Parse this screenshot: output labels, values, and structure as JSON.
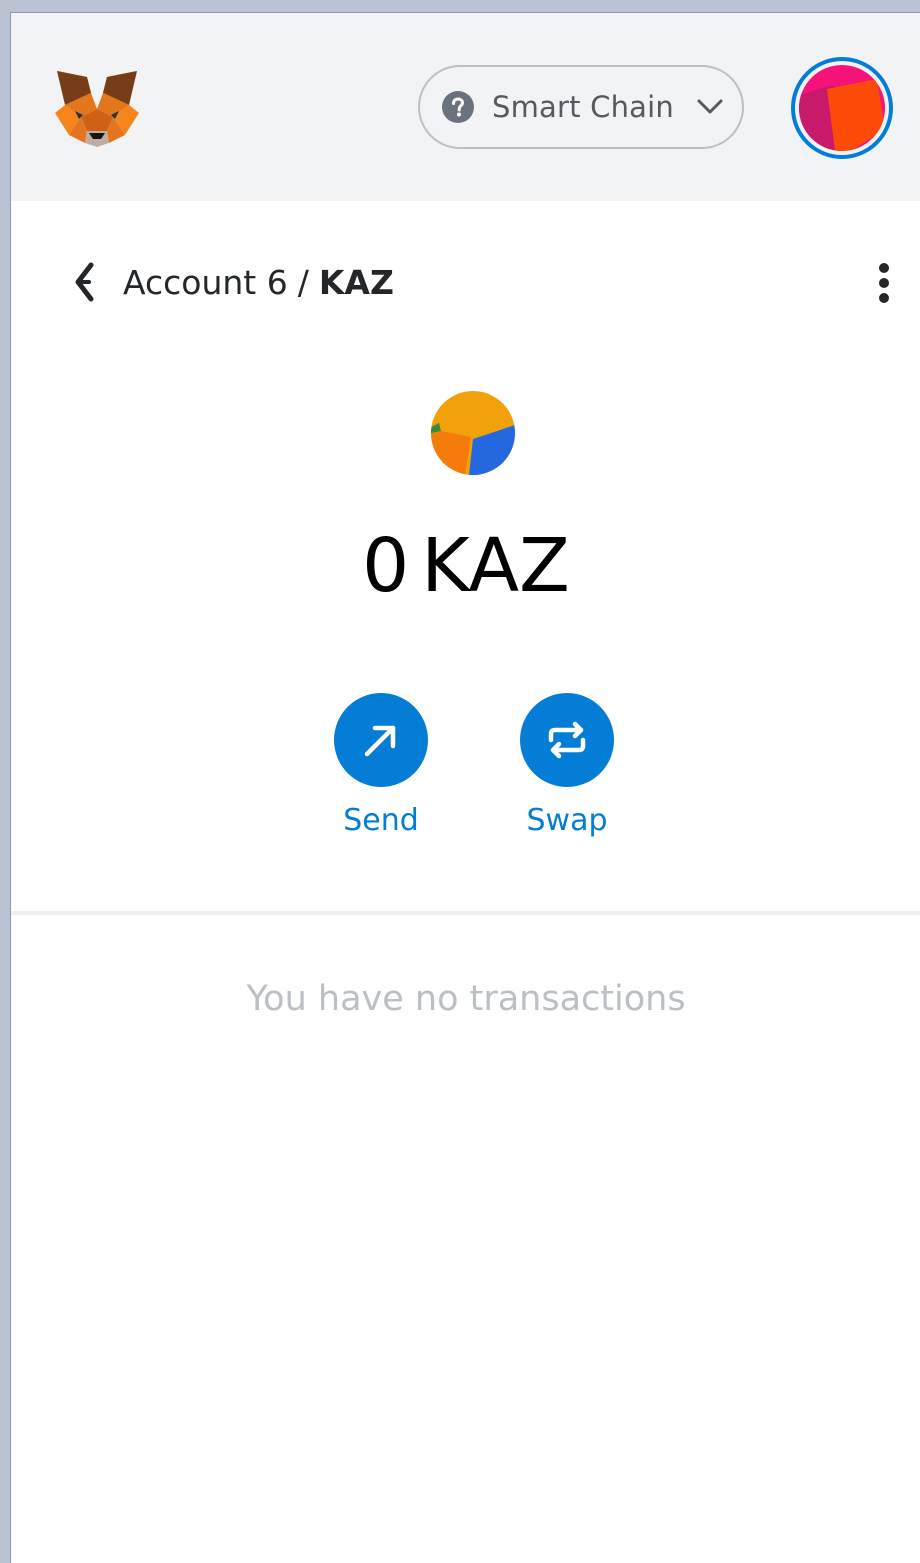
{
  "header": {
    "logo_icon": "metamask-fox-icon",
    "network": {
      "label": "Smart Chain",
      "icon": "question-circle-icon",
      "dropdown_icon": "chevron-down-icon"
    },
    "account_avatar_icon": "identicon-avatar-icon",
    "accent_color": "#037dd6"
  },
  "breadcrumb": {
    "account": "Account 6",
    "separator": "/",
    "token": "KAZ"
  },
  "token": {
    "icon": "token-identicon-icon",
    "balance": "0",
    "symbol": "KAZ"
  },
  "actions": {
    "send_label": "Send",
    "swap_label": "Swap"
  },
  "transactions": {
    "empty_message": "You have no transactions"
  }
}
